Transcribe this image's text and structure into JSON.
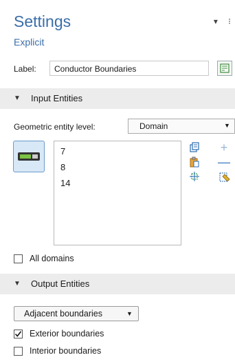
{
  "header": {
    "title": "Settings",
    "subtitle": "Explicit",
    "window_icons": "▾ ⁝"
  },
  "label_row": {
    "label": "Label:",
    "value": "Conductor Boundaries",
    "button_icon": "edit-label-icon"
  },
  "input_entities": {
    "section_label": "Input Entities",
    "geometric_level_label": "Geometric entity level:",
    "geometric_level_value": "Domain",
    "selection_list": [
      "7",
      "8",
      "14"
    ],
    "toggle_icon": "active-selection-toggle-icon",
    "side_icons": [
      "copy-selection-icon",
      "paste-selection-icon",
      "zoom-to-selection-icon"
    ],
    "action_icons": [
      "add-icon",
      "remove-icon",
      "clear-selection-icon"
    ],
    "all_domains_label": "All domains",
    "all_domains_checked": false
  },
  "output_entities": {
    "section_label": "Output Entities",
    "dropdown_value": "Adjacent boundaries",
    "exterior_label": "Exterior boundaries",
    "exterior_checked": true,
    "interior_label": "Interior boundaries",
    "interior_checked": false
  },
  "colors": {
    "title_blue": "#3b6ea8",
    "section_bg": "#ececec",
    "toggle_green": "#7cc243"
  }
}
